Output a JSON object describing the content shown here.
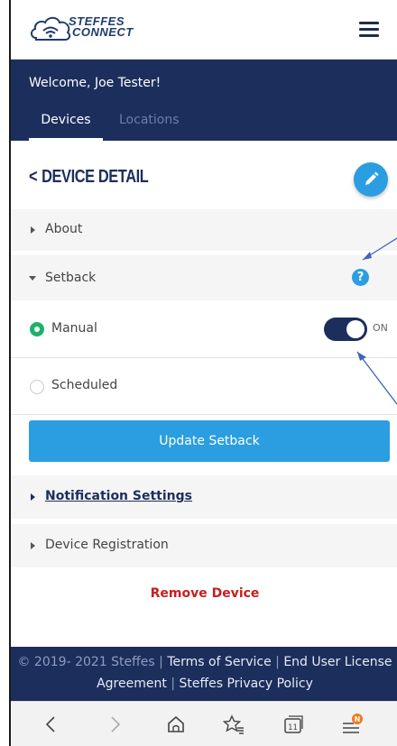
{
  "header": {
    "logo_line1": "STEFFES",
    "logo_line2": "CONNECT"
  },
  "nav": {
    "welcome": "Welcome, Joe Tester!",
    "tabs": [
      {
        "label": "Devices",
        "active": true
      },
      {
        "label": "Locations",
        "active": false
      }
    ]
  },
  "detail": {
    "back_chevron": "<",
    "title": "DEVICE DETAIL"
  },
  "sections": {
    "about": "About",
    "setback": "Setback",
    "manual": "Manual",
    "manual_toggle_state": "ON",
    "scheduled": "Scheduled",
    "help_glyph": "?",
    "update_button": "Update Setback",
    "notification_settings": "Notification Settings",
    "device_registration": "Device Registration",
    "remove_device": "Remove Device"
  },
  "footer": {
    "copyright": "© 2019- 2021 Steffes",
    "terms": "Terms of Service",
    "eula_line1": "End User License",
    "eula_line2": "Agreement",
    "privacy": "Steffes Privacy Policy",
    "separator": "|"
  },
  "browser": {
    "tabs_count": "11",
    "notification_badge": "N"
  },
  "colors": {
    "navy": "#1c2e5c",
    "accent_blue": "#2a9ee0",
    "selected_green": "#1bb36b",
    "remove_red": "#c81e1e"
  },
  "icons": [
    "hamburger-icon",
    "pencil-icon",
    "help-icon",
    "back-icon",
    "forward-icon",
    "home-icon",
    "favorite-icon",
    "tabs-icon",
    "menu-icon"
  ]
}
